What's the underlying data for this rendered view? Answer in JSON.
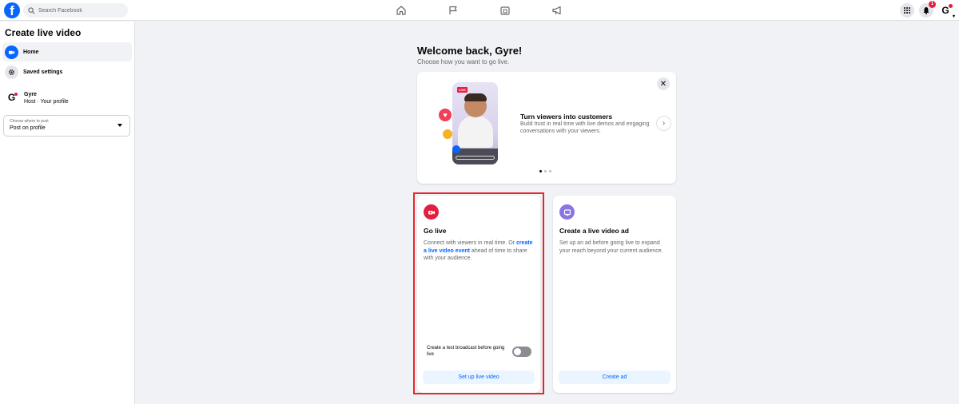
{
  "topbar": {
    "logo": "f",
    "search_placeholder": "Search Facebook",
    "nav": [
      "home-icon",
      "flag-icon",
      "marketplace-icon",
      "megaphone-icon"
    ],
    "notifications_count": "1",
    "profile_initial": "G"
  },
  "sidebar": {
    "title": "Create live video",
    "items": [
      {
        "label": "Home",
        "icon": "video-camera-icon"
      },
      {
        "label": "Saved settings",
        "icon": "gear-icon"
      }
    ],
    "host": {
      "initial": "G",
      "name": "Gyre",
      "subtitle": "Host · Your profile"
    },
    "post_select": {
      "label": "Choose where to post",
      "value": "Post on profile"
    }
  },
  "main": {
    "welcome": "Welcome back, Gyre!",
    "welcome_sub": "Choose how you want to go live.",
    "promo": {
      "live_badge": "LIVE",
      "title": "Turn viewers into customers",
      "text": "Build trust in real time with live demos and engaging conversations with your viewers.",
      "dots": 3,
      "active_dot": 0
    },
    "go_live": {
      "title": "Go live",
      "text_before": "Connect with viewers in real time. Or ",
      "link": "create a live video event",
      "text_after": " ahead of time to share with your audience.",
      "toggle_label": "Create a test broadcast before going live",
      "button": "Set up live video"
    },
    "ad": {
      "title": "Create a live video ad",
      "text": "Set up an ad before going live to expand your reach beyond your current audience.",
      "button": "Create ad"
    }
  },
  "colors": {
    "brand": "#0866ff",
    "live_red": "#e41e3f",
    "ad_purple": "#8b74e6",
    "highlight": "#e4262d"
  }
}
